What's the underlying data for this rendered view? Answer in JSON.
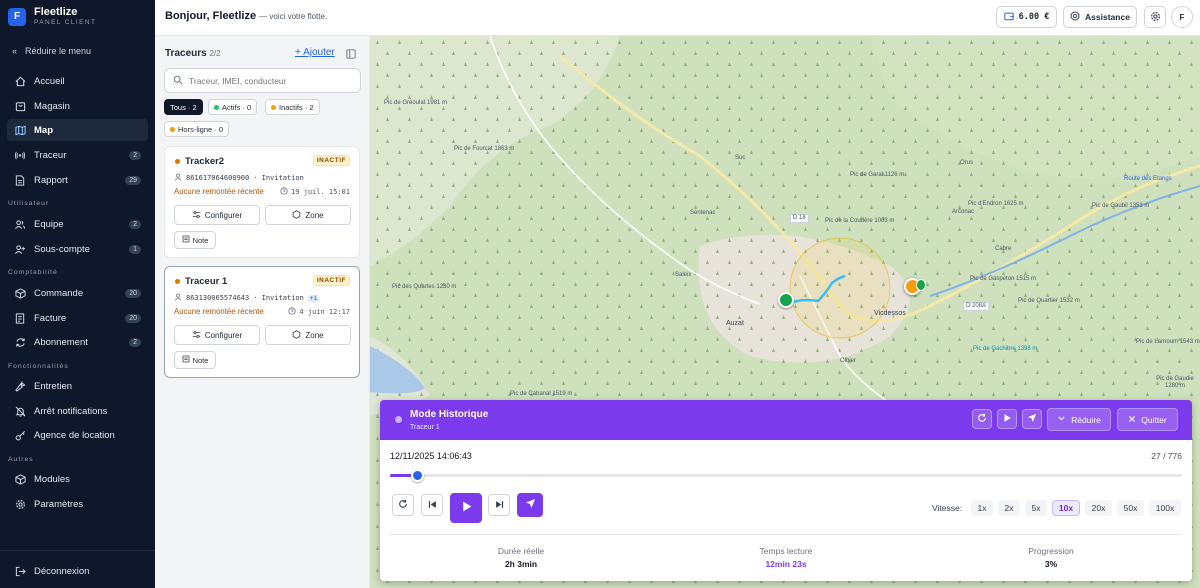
{
  "brand": {
    "initial": "F",
    "name": "Fleetlize",
    "subtitle": "PANEL CLIENT"
  },
  "sidebar": {
    "collapse_label": "Réduire le menu",
    "items": [
      {
        "label": "Accueil",
        "badge": ""
      },
      {
        "label": "Magasin",
        "badge": ""
      },
      {
        "label": "Map",
        "badge": "",
        "active": true
      },
      {
        "label": "Traceur",
        "badge": "2"
      },
      {
        "label": "Rapport",
        "badge": "29"
      },
      {
        "label": "Equipe",
        "badge": "2"
      },
      {
        "label": "Sous-compte",
        "badge": "1"
      },
      {
        "label": "Commande",
        "badge": "20"
      },
      {
        "label": "Facture",
        "badge": "20"
      },
      {
        "label": "Abonnement",
        "badge": "2"
      },
      {
        "label": "Entretien",
        "badge": ""
      },
      {
        "label": "Arrêt notifications",
        "badge": ""
      },
      {
        "label": "Agence de location",
        "badge": ""
      },
      {
        "label": "Modules",
        "badge": ""
      },
      {
        "label": "Paramètres",
        "badge": ""
      }
    ],
    "sections": [
      "Utilisateur",
      "Comptabilité",
      "Fonctionnalités",
      "Autres"
    ],
    "logout_label": "Déconnexion"
  },
  "header": {
    "greeting": "Bonjour, Fleetlize",
    "greeting_sub": "— voici votre flotte.",
    "balance": "6.00 €",
    "assistance_label": "Assistance",
    "avatar_initial": "F"
  },
  "trackers_panel": {
    "title": "Traceurs",
    "count": "2/2",
    "add_label": "+ Ajouter",
    "search_placeholder": "Traceur, IMEI, conducteur",
    "filters": [
      {
        "label": "Tous · 2",
        "active": true
      },
      {
        "label": "Actifs · 0",
        "color": "#22c55e"
      },
      {
        "label": "Inactifs · 2",
        "color": "#f59e0b"
      },
      {
        "label": "Hors-ligne · 0",
        "color": "#f59e0b"
      }
    ],
    "cards": [
      {
        "name": "Tracker2",
        "status": "INACTIF",
        "imei": "861617064600900",
        "imei_suffix": "· Invitation",
        "extra": "",
        "warning": "Aucune remontée récente",
        "date": "19 juil. 15:01",
        "configure_label": "Configurer",
        "zone_label": "Zone",
        "note_label": "Note"
      },
      {
        "name": "Traceur 1",
        "status": "INACTIF",
        "imei": "863130065574643",
        "imei_suffix": "· Invitation",
        "extra": "+1",
        "warning": "Aucune remontée récente",
        "date": "4 juin 12:17",
        "configure_label": "Configurer",
        "zone_label": "Zone",
        "note_label": "Note"
      }
    ]
  },
  "map": {
    "labels": [
      "Pic de Gréoulat 1981 m",
      "Pic de Fourcat 1863 m",
      "Pic de Garal 1126 m",
      "Pic d'Endron 1625 m",
      "Pic de Gaubil 1353 m",
      "Pic de la Coudère 1003 m",
      "Pic de Gaspeton 1515 m",
      "Pic des Quartes 1230 m",
      "Pic de Quartier 1532 m",
      "Sentenac",
      "Arconac",
      "Cabre",
      "Auzat",
      "Vicdessos",
      "Olbier",
      "Saleix",
      "Suc",
      "Orus",
      "D 18",
      "D 208A",
      "Route des Etangs",
      "Pic de Gachibre 1398 m",
      "Pic de Larnoum 1543 m",
      "Pic de Gaudie 1280 m",
      "Pic de Cabanal 1519 m"
    ]
  },
  "history": {
    "title": "Mode Historique",
    "subtitle": "Traceur 1",
    "reduce_label": "Réduire",
    "quit_label": "Quitter",
    "datetime": "12/11/2025 14:06:43",
    "position": "27 / 776",
    "progress": 0.034,
    "speed_label": "Vitesse:",
    "speeds": [
      "1x",
      "2x",
      "5x",
      "10x",
      "20x",
      "50x",
      "100x"
    ],
    "active_speed": "10x",
    "stats": [
      {
        "label": "Durée réelle",
        "value": "2h 3min",
        "highlight": false
      },
      {
        "label": "Temps lecture",
        "value": "12min 23s",
        "highlight": true
      },
      {
        "label": "Progression",
        "value": "3%",
        "highlight": false
      }
    ]
  },
  "colors": {
    "accent": "#7c3aed",
    "sidebar_bg": "#0f172a",
    "primary": "#2563eb"
  }
}
